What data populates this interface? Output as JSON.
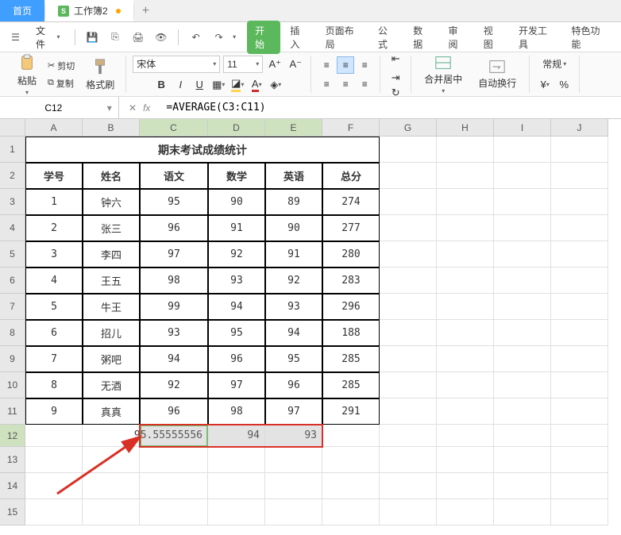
{
  "tabs": {
    "home": "首页",
    "workbook": "工作簿2"
  },
  "file_menu": "文件",
  "ribbon_tabs": [
    "开始",
    "插入",
    "页面布局",
    "公式",
    "数据",
    "审阅",
    "视图",
    "开发工具",
    "特色功能"
  ],
  "clipboard": {
    "paste": "粘贴",
    "cut": "剪切",
    "copy": "复制",
    "format_painter": "格式刷"
  },
  "font": {
    "name": "宋体",
    "size": "11"
  },
  "merge": "合并居中",
  "wrap": "自动换行",
  "number_format": "常规",
  "namebox": "C12",
  "formula": "=AVERAGE(C3:C11)",
  "columns": [
    "A",
    "B",
    "C",
    "D",
    "E",
    "F",
    "G",
    "H",
    "I",
    "J"
  ],
  "sheet": {
    "title": "期末考试成绩统计",
    "headers": [
      "学号",
      "姓名",
      "语文",
      "数学",
      "英语",
      "总分"
    ],
    "rows": [
      [
        "1",
        "钟六",
        "95",
        "90",
        "89",
        "274"
      ],
      [
        "2",
        "张三",
        "96",
        "91",
        "90",
        "277"
      ],
      [
        "3",
        "李四",
        "97",
        "92",
        "91",
        "280"
      ],
      [
        "4",
        "王五",
        "98",
        "93",
        "92",
        "283"
      ],
      [
        "5",
        "牛王",
        "99",
        "94",
        "93",
        "296"
      ],
      [
        "6",
        "招儿",
        "93",
        "95",
        "94",
        "188"
      ],
      [
        "7",
        "粥吧",
        "94",
        "96",
        "95",
        "285"
      ],
      [
        "8",
        "无酒",
        "92",
        "97",
        "96",
        "285"
      ],
      [
        "9",
        "真真",
        "96",
        "98",
        "97",
        "291"
      ]
    ],
    "avg": [
      "95.55555556",
      "94",
      "93"
    ]
  }
}
